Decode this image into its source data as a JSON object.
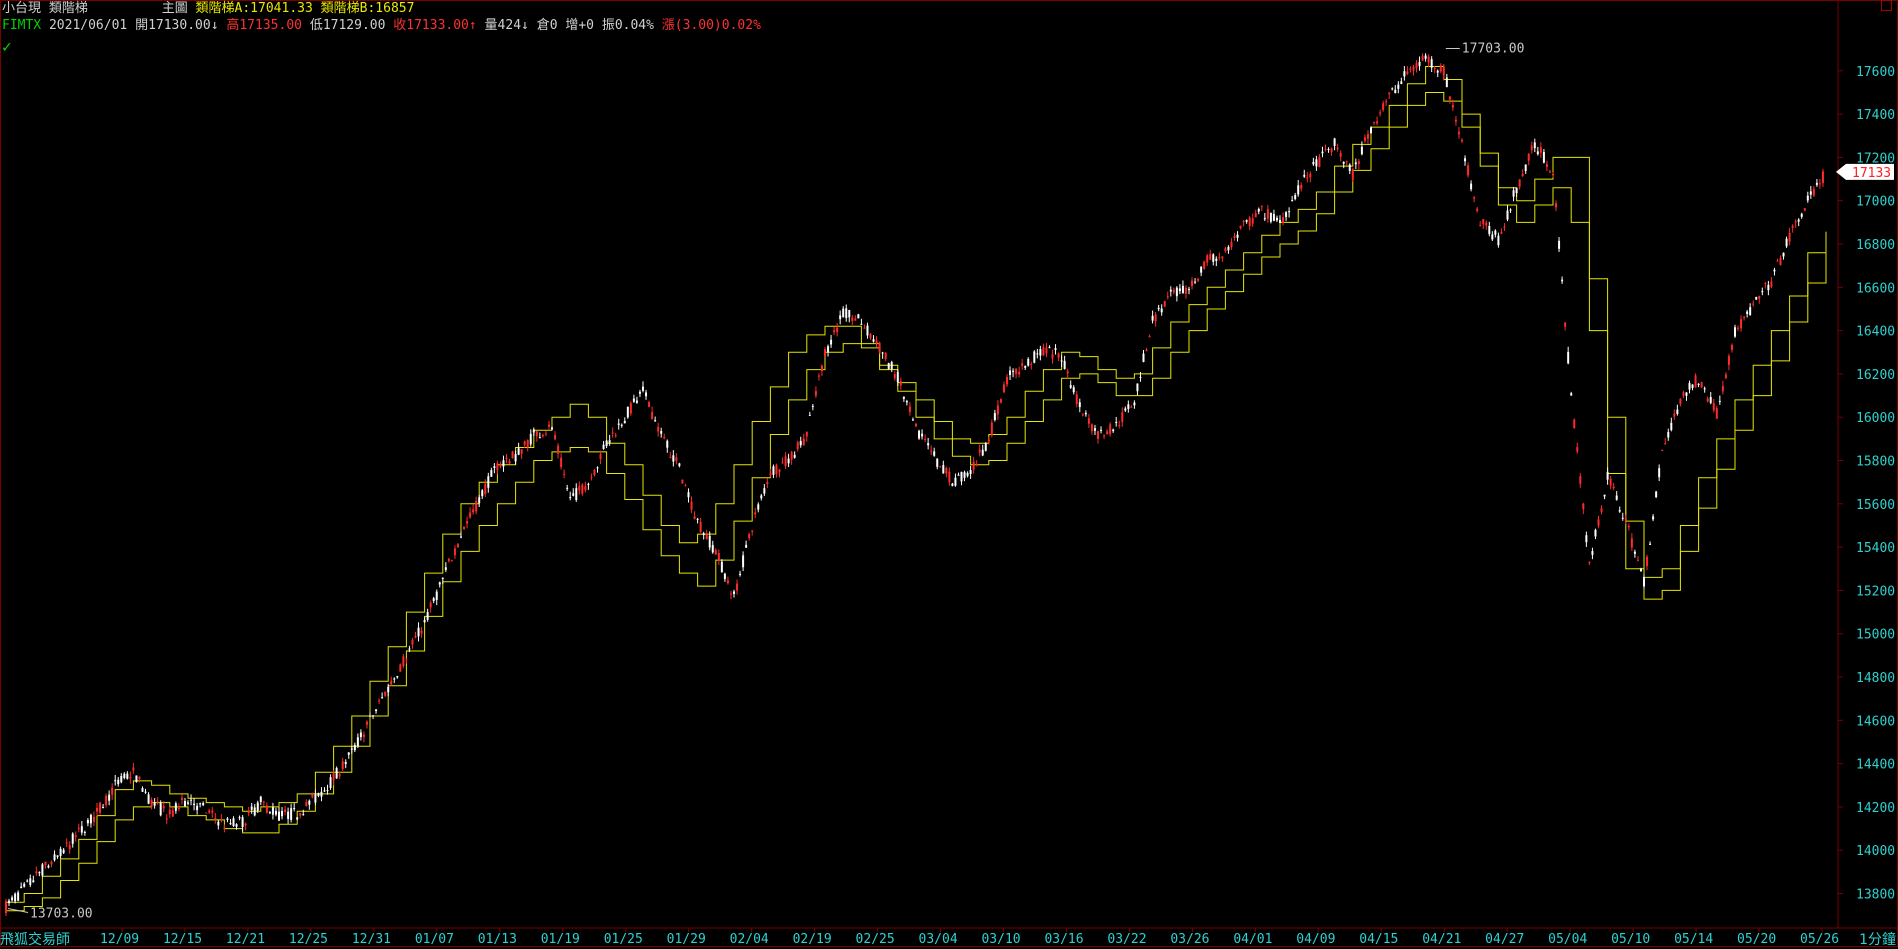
{
  "header": {
    "symbol_name": "小台現",
    "indicator_name": "類階梯",
    "pane_label": "主圖",
    "indicator_a": "類階梯A:17041.33",
    "indicator_b": "類階梯B:16857",
    "code": "FIMTX",
    "date": "2021/06/01",
    "open": "開17130.00",
    "down_arrow_1": "↓",
    "high": "高17135.00",
    "low": "低17129.00",
    "close": "收17133.00",
    "up_arrow": "↑",
    "volume": "量424",
    "down_arrow_2": "↓",
    "oi": "倉0",
    "oi_change": "增+0",
    "amplitude": "振0.04%",
    "change": "漲(3.00)0.02%"
  },
  "footer": {
    "left_label": "飛狐交易師",
    "timeframe": "1分鐘"
  },
  "colors": {
    "background": "#000000",
    "up": "#ff2a2a",
    "down": "#ffffff",
    "indicator": "#e6e600",
    "axis_text": "#30d0d0",
    "frame": "#7a0000"
  },
  "chart_data": {
    "type": "candlestick",
    "xlabel": "",
    "ylabel": "",
    "ylim": [
      13650,
      17770
    ],
    "y_ticks": [
      13800,
      14000,
      14200,
      14400,
      14600,
      14800,
      15000,
      15200,
      15400,
      15600,
      15800,
      16000,
      16200,
      16400,
      16600,
      16800,
      17000,
      17200,
      17400,
      17600
    ],
    "x_tick_labels": [
      "12/09",
      "12/15",
      "12/21",
      "12/25",
      "12/31",
      "01/07",
      "01/13",
      "01/19",
      "01/25",
      "01/29",
      "02/04",
      "02/19",
      "02/25",
      "03/04",
      "03/10",
      "03/16",
      "03/22",
      "03/26",
      "04/01",
      "04/09",
      "04/15",
      "04/21",
      "04/27",
      "05/04",
      "05/10",
      "05/14",
      "05/20",
      "05/26"
    ],
    "close_series": [
      13740,
      13820,
      13910,
      13980,
      14080,
      14170,
      14300,
      14360,
      14220,
      14160,
      14240,
      14180,
      14120,
      14130,
      14220,
      14160,
      14170,
      14240,
      14330,
      14450,
      14600,
      14750,
      14900,
      15050,
      15250,
      15460,
      15620,
      15780,
      15820,
      15920,
      15950,
      15620,
      15700,
      15880,
      16000,
      16120,
      15920,
      15760,
      15520,
      15380,
      15170,
      15500,
      15750,
      15800,
      15920,
      16300,
      16480,
      16440,
      16320,
      16180,
      15940,
      15820,
      15700,
      15750,
      15900,
      16180,
      16240,
      16310,
      16280,
      16050,
      15920,
      15960,
      16080,
      16450,
      16560,
      16590,
      16720,
      16760,
      16880,
      16950,
      16900,
      17050,
      17170,
      17260,
      17120,
      17340,
      17480,
      17590,
      17660,
      17600,
      17260,
      16900,
      16820,
      17060,
      17260,
      17140,
      16100,
      15320,
      15720,
      15520,
      15240,
      15840,
      16080,
      16180,
      16020,
      16390,
      16510,
      16630,
      16830,
      17000,
      17133
    ],
    "high_label": "17703.00",
    "low_label": "13703.00",
    "last_price": "17133",
    "indicator_a_series": [
      13760,
      13800,
      13880,
      13960,
      14050,
      14160,
      14280,
      14320,
      14300,
      14260,
      14240,
      14220,
      14200,
      14180,
      14200,
      14220,
      14260,
      14360,
      14480,
      14620,
      14780,
      14940,
      15100,
      15280,
      15460,
      15600,
      15700,
      15780,
      15860,
      15940,
      16000,
      16060,
      16000,
      15880,
      15780,
      15640,
      15500,
      15420,
      15460,
      15600,
      15780,
      15980,
      16140,
      16300,
      16380,
      16420,
      16420,
      16340,
      16240,
      16160,
      16080,
      15980,
      15900,
      15880,
      15920,
      16000,
      16120,
      16220,
      16300,
      16280,
      16220,
      16180,
      16200,
      16320,
      16440,
      16520,
      16600,
      16680,
      16760,
      16840,
      16900,
      16960,
      17040,
      17160,
      17260,
      17340,
      17440,
      17540,
      17620,
      17560,
      17400,
      17220,
      17060,
      17000,
      17100,
      17200,
      17200,
      16640,
      16000,
      15520,
      15260,
      15300,
      15500,
      15720,
      15900,
      16080,
      16240,
      16400,
      16560,
      16760,
      16857
    ],
    "indicator_b_series": [
      13720,
      13740,
      13780,
      13860,
      13940,
      14040,
      14140,
      14200,
      14220,
      14200,
      14160,
      14140,
      14100,
      14080,
      14080,
      14120,
      14180,
      14260,
      14360,
      14480,
      14620,
      14760,
      14920,
      15080,
      15240,
      15380,
      15500,
      15600,
      15700,
      15800,
      15840,
      15860,
      15840,
      15740,
      15620,
      15480,
      15360,
      15280,
      15220,
      15340,
      15520,
      15720,
      15920,
      16080,
      16220,
      16300,
      16340,
      16320,
      16220,
      16120,
      16000,
      15900,
      15820,
      15780,
      15800,
      15880,
      15980,
      16080,
      16180,
      16200,
      16160,
      16100,
      16100,
      16180,
      16300,
      16400,
      16500,
      16580,
      16660,
      16740,
      16800,
      16860,
      16940,
      17040,
      17140,
      17240,
      17340,
      17440,
      17500,
      17460,
      17340,
      17160,
      16980,
      16900,
      16980,
      17060,
      16900,
      16400,
      15740,
      15300,
      15160,
      15200,
      15380,
      15580,
      15760,
      15940,
      16100,
      16260,
      16440,
      16620,
      16857
    ]
  }
}
